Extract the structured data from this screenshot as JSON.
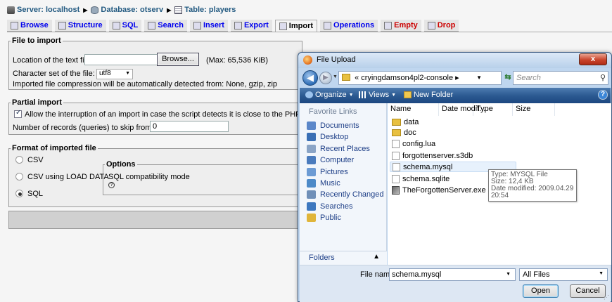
{
  "breadcrumb": {
    "server": "Server: localhost",
    "database": "Database: otserv",
    "table": "Table: players"
  },
  "tabs": [
    {
      "label": "Browse",
      "icon": "browse-icon"
    },
    {
      "label": "Structure",
      "icon": "structure-icon"
    },
    {
      "label": "SQL",
      "icon": "sql-icon"
    },
    {
      "label": "Search",
      "icon": "search-icon"
    },
    {
      "label": "Insert",
      "icon": "insert-icon"
    },
    {
      "label": "Export",
      "icon": "export-icon"
    },
    {
      "label": "Import",
      "icon": "import-icon",
      "active": true
    },
    {
      "label": "Operations",
      "icon": "operations-icon"
    },
    {
      "label": "Empty",
      "icon": "empty-icon",
      "red": true
    },
    {
      "label": "Drop",
      "icon": "drop-icon",
      "red": true
    }
  ],
  "file_import": {
    "legend": "File to import",
    "location_label": "Location of the text file",
    "browse_label": "Browse...",
    "max_label": "(Max: 65,536 KiB)",
    "charset_label": "Character set of the file:",
    "charset_value": "utf8",
    "compression_note": "Imported file compression will be automatically detected from: None, gzip, zip"
  },
  "partial_import": {
    "legend": "Partial import",
    "allow_interrupt_label": "Allow the interruption of an import in case the script detects it is close to the PHP timeout l",
    "allow_interrupt_checked": true,
    "skip_label": "Number of records (queries) to skip from start",
    "skip_value": "0"
  },
  "format": {
    "legend": "Format of imported file",
    "options": [
      "CSV",
      "CSV using LOAD DATA",
      "SQL"
    ],
    "selected": "SQL",
    "options_legend": "Options",
    "compat_label": "SQL compatibility mode",
    "help_glyph": "?"
  },
  "dialog": {
    "title": "File Upload",
    "close_glyph": "x",
    "address_prefix": "«",
    "address_path": "cryingdamson4pl2-console",
    "address_arrow": "▸",
    "search_placeholder": "Search",
    "toolbar": {
      "organize": "Organize",
      "views": "Views",
      "new_folder": "New Folder",
      "help_glyph": "?"
    },
    "nav_header": "Favorite Links",
    "favorites": [
      {
        "label": "Documents",
        "color": "#5b87c9"
      },
      {
        "label": "Desktop",
        "color": "#3a6fb5"
      },
      {
        "label": "Recent Places",
        "color": "#8aa4c6"
      },
      {
        "label": "Computer",
        "color": "#4a7bbd"
      },
      {
        "label": "Pictures",
        "color": "#6c9bd4"
      },
      {
        "label": "Music",
        "color": "#4d8ac8"
      },
      {
        "label": "Recently Changed",
        "color": "#6f8fb8"
      },
      {
        "label": "Searches",
        "color": "#3d77bf"
      },
      {
        "label": "Public",
        "color": "#e0b53a"
      }
    ],
    "folders_label": "Folders",
    "columns": [
      "Name",
      "Date modif...",
      "Type",
      "Size"
    ],
    "files": [
      {
        "name": "data",
        "kind": "folder"
      },
      {
        "name": "doc",
        "kind": "folder"
      },
      {
        "name": "config.lua",
        "kind": "doc"
      },
      {
        "name": "forgottenserver.s3db",
        "kind": "doc"
      },
      {
        "name": "schema.mysql",
        "kind": "doc",
        "selected": true
      },
      {
        "name": "schema.sqlite",
        "kind": "doc"
      },
      {
        "name": "TheForgottenServer.exe",
        "kind": "exe"
      }
    ],
    "tooltip": {
      "type": "Type: MYSQL File",
      "size": "Size: 12,4 KB",
      "modified": "Date modified: 2009.04.29 20:54"
    },
    "file_name_label": "File name:",
    "file_name_value": "schema.mysql",
    "filter_value": "All Files",
    "open_label": "Open",
    "cancel_label": "Cancel"
  }
}
